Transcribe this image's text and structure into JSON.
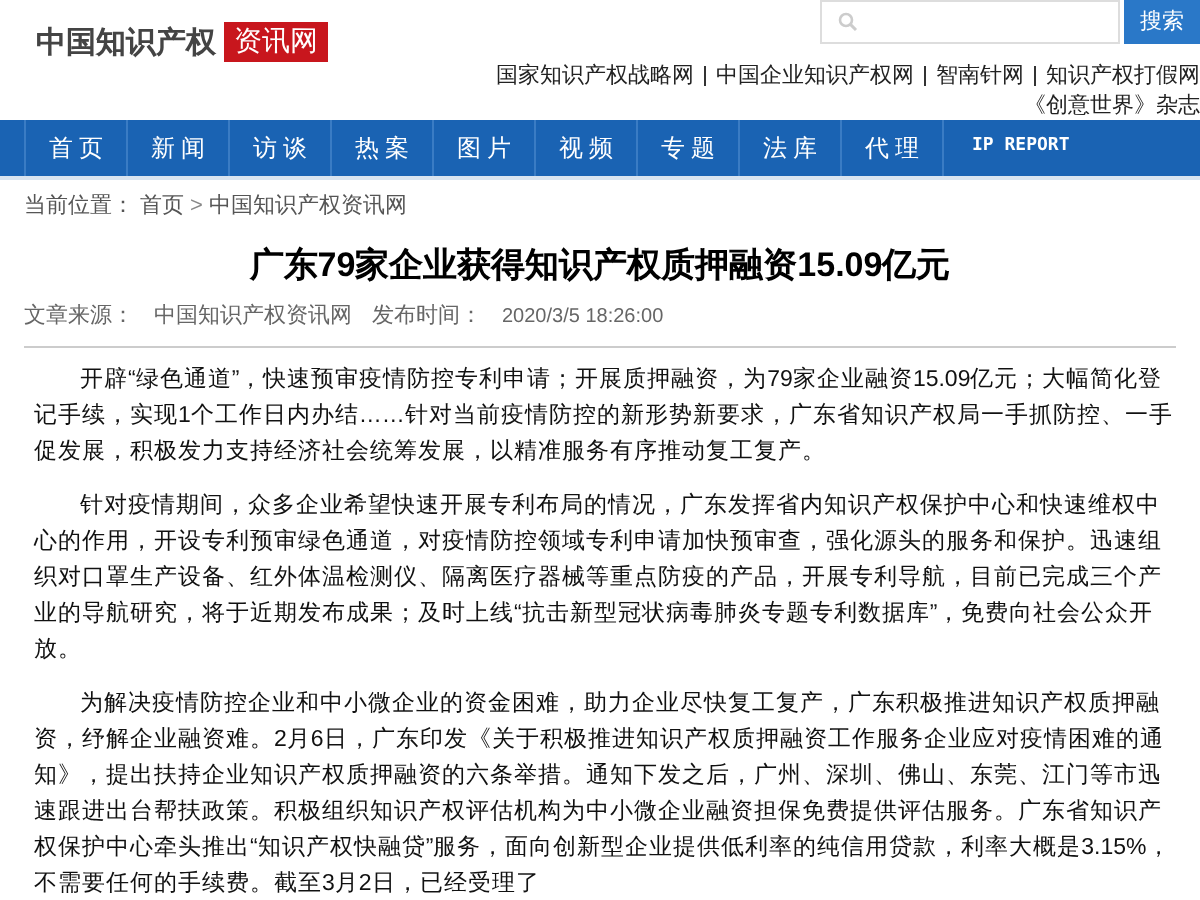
{
  "logo": {
    "name": "中国知识产权",
    "badge": "资讯网"
  },
  "search": {
    "button": "搜索"
  },
  "top_links": [
    {
      "label": "国家知识产权战略网"
    },
    {
      "label": "中国企业知识产权网"
    },
    {
      "label": "智南针网"
    },
    {
      "label": "知识产权打假网"
    }
  ],
  "top_links_line2": "《创意世界》杂志",
  "nav": [
    {
      "label": "首 页"
    },
    {
      "label": "新 闻"
    },
    {
      "label": "访 谈"
    },
    {
      "label": "热 案"
    },
    {
      "label": "图 片"
    },
    {
      "label": "视 频"
    },
    {
      "label": "专 题"
    },
    {
      "label": "法 库"
    },
    {
      "label": "代 理"
    },
    {
      "label": "IP REPORT"
    }
  ],
  "breadcrumb": {
    "prefix": "当前位置：",
    "items": [
      "首页",
      "中国知识产权资讯网"
    ],
    "separator": ">"
  },
  "article": {
    "title": "广东79家企业获得知识产权质押融资15.09亿元",
    "source_label": "文章来源：",
    "source": "中国知识产权资讯网",
    "time_label": "发布时间：",
    "time": "2020/3/5 18:26:00",
    "paragraphs": [
      "开辟“绿色通道”，快速预审疫情防控专利申请；开展质押融资，为79家企业融资15.09亿元；大幅简化登记手续，实现1个工作日内办结……针对当前疫情防控的新形势新要求，广东省知识产权局一手抓防控、一手促发展，积极发力支持经济社会统筹发展，以精准服务有序推动复工复产。",
      "针对疫情期间，众多企业希望快速开展专利布局的情况，广东发挥省内知识产权保护中心和快速维权中心的作用，开设专利预审绿色通道，对疫情防控领域专利申请加快预审查，强化源头的服务和保护。迅速组织对口罩生产设备、红外体温检测仪、隔离医疗器械等重点防疫的产品，开展专利导航，目前已完成三个产业的导航研究，将于近期发布成果；及时上线“抗击新型冠状病毒肺炎专题专利数据库”，免费向社会公众开放。",
      "为解决疫情防控企业和中小微企业的资金困难，助力企业尽快复工复产，广东积极推进知识产权质押融资，纾解企业融资难。2月6日，广东印发《关于积极推进知识产权质押融资工作服务企业应对疫情困难的通知》，提出扶持企业知识产权质押融资的六条举措。通知下发之后，广州、深圳、佛山、东莞、江门等市迅速跟进出台帮扶政策。积极组织知识产权评估机构为中小微企业融资担保免费提供评估服务。广东省知识产权保护中心牵头推出“知识产权快融贷”服务，面向创新型企业提供低利率的纯信用贷款，利率大概是3.15%，不需要任何的手续费。截至3月2日，已经受理了"
    ]
  }
}
